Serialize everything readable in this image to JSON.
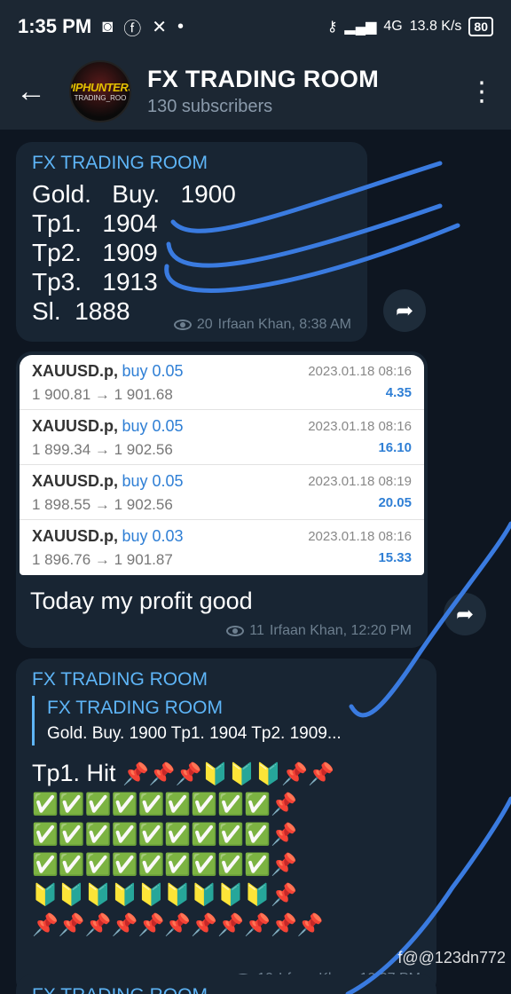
{
  "status_bar": {
    "time": "1:35 PM",
    "network_speed": "13.8 K/s",
    "battery": "80",
    "signal_4g": "4G"
  },
  "header": {
    "title": "FX TRADING ROOM",
    "subscribers": "130 subscribers",
    "avatar_text_1": "PIPHUNTERS",
    "avatar_text_2": "TRADING_ROO"
  },
  "messages": [
    {
      "sender": "FX TRADING ROOM",
      "lines": [
        "Gold.   Buy.   1900",
        "Tp1.   1904",
        "Tp2.   1909",
        "Tp3.   1913",
        "Sl.  1888"
      ],
      "views": "20",
      "author_time": "Irfaan Khan, 8:38 AM"
    },
    {
      "trades": [
        {
          "symbol": "XAUUSD.p,",
          "side": "buy 0.05",
          "prices": "1 900.81 → 1 901.68",
          "date": "2023.01.18 08:16",
          "profit": "4.35"
        },
        {
          "symbol": "XAUUSD.p,",
          "side": "buy 0.05",
          "prices": "1 899.34 → 1 902.56",
          "date": "2023.01.18 08:16",
          "profit": "16.10"
        },
        {
          "symbol": "XAUUSD.p,",
          "side": "buy 0.05",
          "prices": "1 898.55 → 1 902.56",
          "date": "2023.01.18 08:19",
          "profit": "20.05"
        },
        {
          "symbol": "XAUUSD.p,",
          "side": "buy 0.03",
          "prices": "1 896.76 → 1 901.87",
          "date": "2023.01.18 08:16",
          "profit": "15.33"
        }
      ],
      "caption": "Today my profit good",
      "views": "11",
      "author_time": "Irfaan Khan, 12:20 PM"
    },
    {
      "sender": "FX TRADING ROOM",
      "reply_title": "FX TRADING ROOM",
      "reply_text": "Gold.   Buy.   1900 Tp1.   1904 Tp2.   1909...",
      "hit_text": "Tp1.  Hit",
      "emoji_rows": [
        "📌📌📌🔰🔰🔰📌📌",
        "✅✅✅✅✅✅✅✅✅📌",
        "✅✅✅✅✅✅✅✅✅📌",
        "✅✅✅✅✅✅✅✅✅📌",
        "🔰🔰🔰🔰🔰🔰🔰🔰🔰📌",
        "📌📌📌📌📌📌📌📌📌📌📌"
      ],
      "views": "10",
      "author_time": "Irfaan Khan, 12:37 PM"
    },
    {
      "sender": "FX TRADING ROOM"
    }
  ],
  "watermark": "f@@123dn772",
  "colors": {
    "accent": "#5eb5f7",
    "bubble": "#182533",
    "background": "#0e1621",
    "header": "#1c2733",
    "stroke": "#3a7be0"
  }
}
